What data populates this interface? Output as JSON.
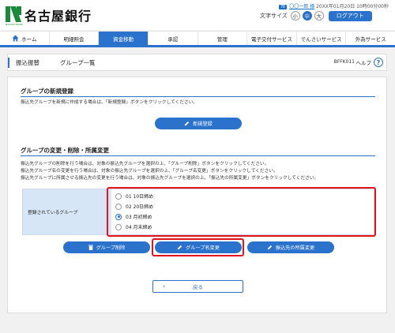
{
  "header": {
    "bank_name": "名古屋銀行",
    "logo_sub": "NAGOYA BANK",
    "user_badge": "7E",
    "user_name": "〇〇一郎 様",
    "last_login": "20XX年01月20日 10時00分00秒",
    "font_size_label": "文字サイズ",
    "font_sizes": [
      "小",
      "中",
      "大"
    ],
    "logout_label": "ログアウト"
  },
  "nav": {
    "items": [
      "ホーム",
      "明細照会",
      "資金移動",
      "承認",
      "管理",
      "電子交付サービス",
      "でんさいサービス",
      "外為サービス"
    ],
    "active_index": 2
  },
  "titlebar": {
    "category": "振込振替",
    "page_title": "グループ一覧",
    "screen_code": "BFFK011",
    "help_label": "ヘルプ",
    "help_glyph": "?"
  },
  "new_section": {
    "title": "グループの新規登録",
    "description": "振込先グループを新規に作成する場合は、「新規登録」ボタンをクリックしてください。",
    "button_label": "新規登録"
  },
  "change_section": {
    "title": "グループの変更・削除・所属変更",
    "descriptions": [
      "振込先グループの削除を行う場合は、対象の振込先グループを選択の上、「グループ削除」ボタンをクリックしてください。",
      "振込先グループ名の変更を行う場合は、対象の振込先グループを選択の上、「グループ名変更」ボタンをクリックしてください。",
      "振込先グループに所属させる振込先の変更を行う場合は、対象の振込先グループを選択の上、「振込先の所属変更」ボタンをクリックしてください。"
    ],
    "field_label": "登録されているグループ",
    "groups": [
      "01 10日締め",
      "02 20日締め",
      "03 月初締め",
      "04 月末締め"
    ],
    "selected_index": 2,
    "buttons": {
      "delete": "グループ削除",
      "rename": "グループ名変更",
      "member_change": "振込先の所属変更"
    }
  },
  "back_label": "戻る",
  "colors": {
    "accent": "#2a72cc",
    "highlight": "#e0141e",
    "label_bg": "#d7e6f7"
  }
}
